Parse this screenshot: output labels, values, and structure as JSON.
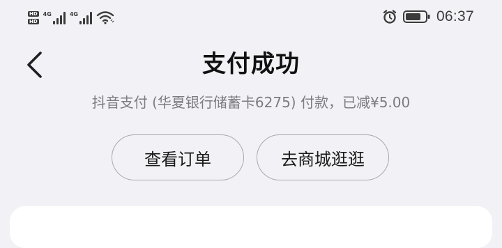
{
  "status_bar": {
    "hd_label": "HD",
    "network_type_1": "4G",
    "network_type_2": "4G",
    "time": "06:37",
    "icons": [
      "hd-icon",
      "signal-icon",
      "wifi-icon",
      "alarm-icon",
      "battery-icon"
    ]
  },
  "header": {
    "title": "支付成功",
    "back_icon": "chevron-left-icon"
  },
  "payment": {
    "summary": "抖音支付 (华夏银行储蓄卡6275) 付款，已减¥5.00"
  },
  "actions": {
    "view_order": "查看订单",
    "go_mall": "去商城逛逛"
  },
  "colors": {
    "background": "#f2f2f6",
    "title_text": "#111111",
    "secondary_text": "#7c7c80",
    "button_border": "#a9a9ad",
    "card": "#ffffff"
  }
}
